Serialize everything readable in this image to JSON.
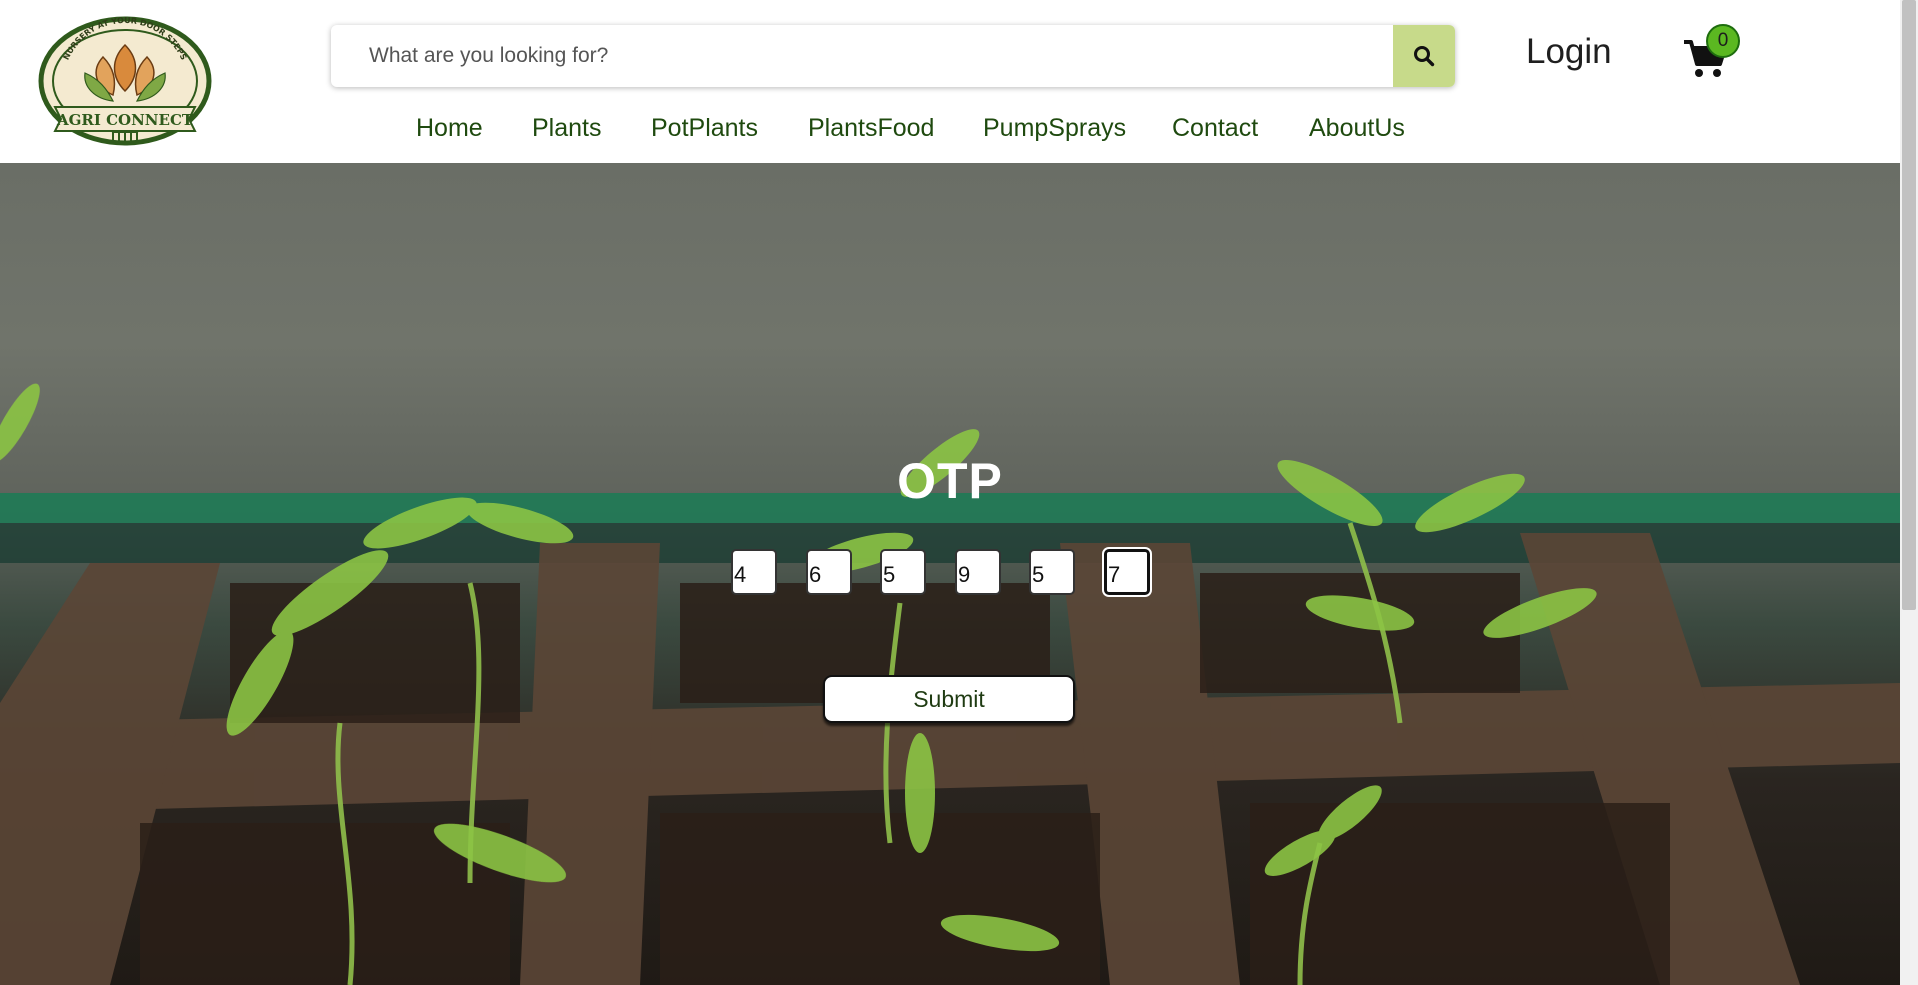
{
  "brand": {
    "arc_text": "NURSERY AT YOUR DOOR STEPS",
    "name": "AGRI CONNECT"
  },
  "search": {
    "placeholder": "What are you looking for?",
    "button_icon": "search-icon"
  },
  "header": {
    "login_label": "Login",
    "cart_icon": "cart-icon",
    "cart_count": "0"
  },
  "nav": {
    "items": [
      {
        "label": "Home"
      },
      {
        "label": "Plants"
      },
      {
        "label": "PotPlants"
      },
      {
        "label": "PlantsFood"
      },
      {
        "label": "PumpSprays"
      },
      {
        "label": "Contact"
      },
      {
        "label": "AboutUs"
      }
    ]
  },
  "otp": {
    "title": "OTP",
    "digits": [
      "4",
      "6",
      "5",
      "9",
      "5",
      "7"
    ],
    "submit_label": "Submit"
  },
  "colors": {
    "search_button": "#c7da8a",
    "nav_text": "#1f4a0f",
    "cart_badge": "#5bb821"
  }
}
